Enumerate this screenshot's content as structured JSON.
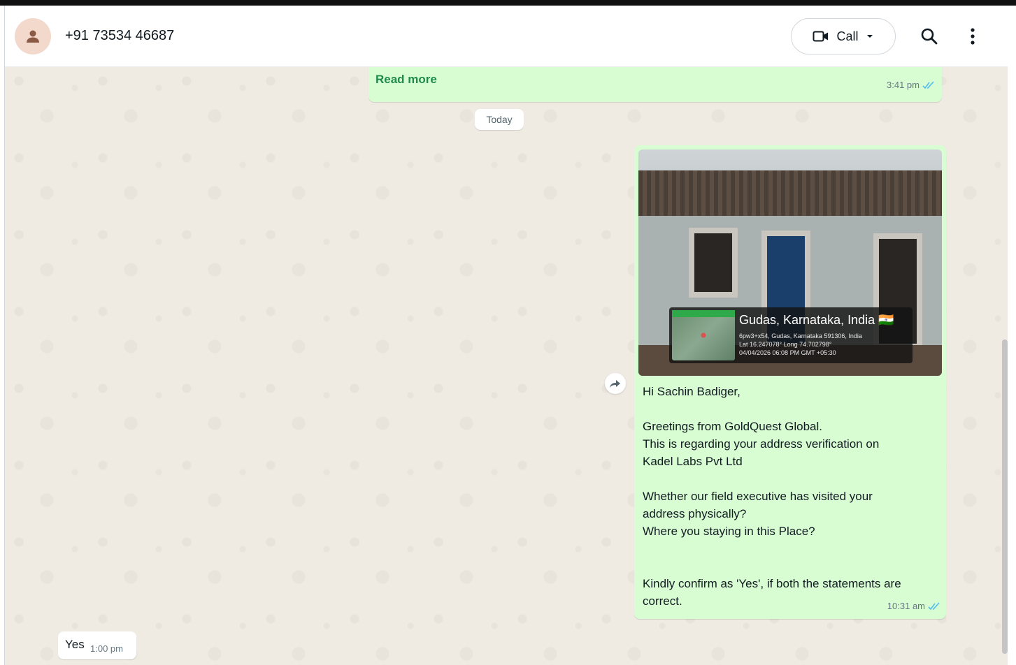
{
  "header": {
    "contact_name": "+91 73534 46687",
    "call_label": "Call"
  },
  "chat": {
    "prev_message": {
      "read_more": "Read more",
      "time": "3:41 pm"
    },
    "date_chip": "Today",
    "photo_message": {
      "geo_title": "Gudas, Karnataka, India 🇮🇳",
      "geo_line1": "6pw3+x54, Gudas, Karnataka 591306, India",
      "geo_line2": "Lat 16.247078° Long 74.702798°",
      "geo_line3": "04/04/2026 06:08 PM GMT +05:30",
      "lines": [
        "Hi Sachin Badiger,",
        "Greetings from GoldQuest Global.",
        "This is regarding your address verification on",
        "Kadel Labs Pvt Ltd",
        "Whether our field executive has visited your",
        "address physically?",
        "Where you staying in this Place?",
        "Kindly confirm as 'Yes', if both the statements are",
        "correct."
      ],
      "time": "10:31 am"
    },
    "reply_message": {
      "text": "Yes",
      "time": "1:00 pm"
    }
  },
  "colors": {
    "outgoing_bubble": "#d9fdd3",
    "chat_background": "#efeae2",
    "read_ticks": "#53bdeb"
  }
}
